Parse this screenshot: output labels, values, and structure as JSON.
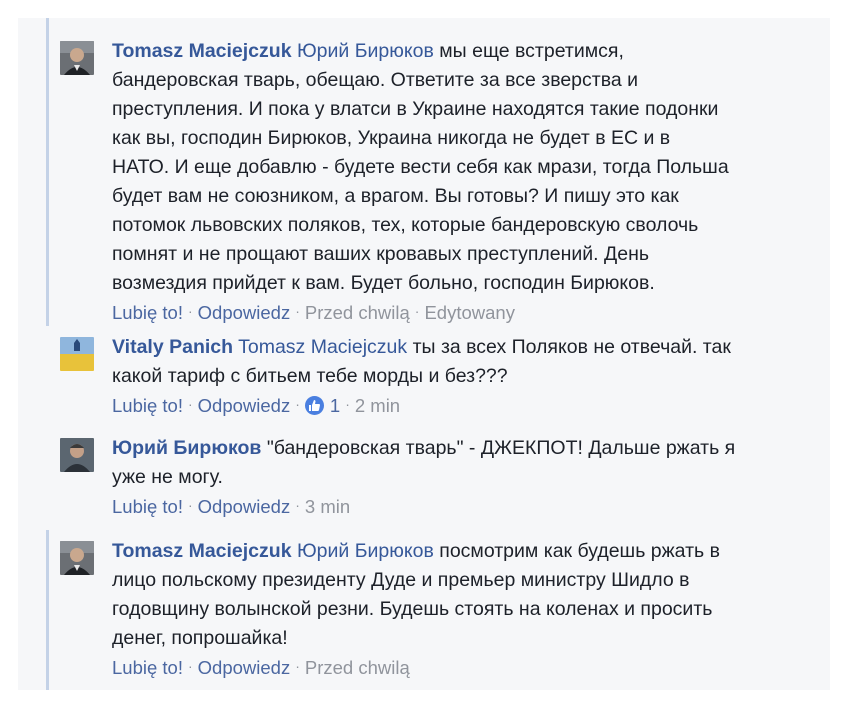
{
  "comments": [
    {
      "author": "Tomasz Maciejczuk",
      "mention": "Юрий Бирюков",
      "lines": [
        "мы еще встретимся,",
        "бандеровская тварь, обещаю. Ответите за все зверства и",
        "преступления. И пока у влатси в Украине находятся такие подонки",
        "как вы, господин Бирюков, Украина никогда не будет в ЕС и в",
        "НАТО. И еще добавлю - будете вести себя как мрази, тогда Польша",
        "будет вам не союзником, а врагом. Вы готовы? И пишу это как",
        "потомок львовских поляков, тех, которые бандеровскую сволочь",
        "помнят и не прощают ваших кровавых преступлений. День",
        "возмездия прийдет к вам. Будет больно, господин Бирюков."
      ],
      "like": "Lubię to!",
      "reply": "Odpowiedz",
      "time": "Przed chwilą",
      "edited": "Edytowany"
    },
    {
      "author": "Vitaly Panich",
      "mention": "Tomasz Maciejczuk",
      "lines": [
        "ты за всех Поляков не отвечай. так",
        "какой тариф с битьем тебе морды и без???"
      ],
      "like": "Lubię to!",
      "reply": "Odpowiedz",
      "reaction_count": "1",
      "time": "2 min"
    },
    {
      "author": "Юрий Бирюков",
      "lines": [
        "\"бандеровская тварь\" - ДЖЕКПОТ! Дальше ржать я",
        "уже не могу."
      ],
      "like": "Lubię to!",
      "reply": "Odpowiedz",
      "time": "3 min"
    },
    {
      "author": "Tomasz Maciejczuk",
      "mention": "Юрий Бирюков",
      "lines": [
        "посмотрим как будешь ржать в",
        "лицо польскому президенту Дуде и премьер министру Шидло в",
        "годовщину волынской резни. Будешь стоять на коленах и просить",
        "денег, попрошайка!"
      ],
      "like": "Lubię to!",
      "reply": "Odpowiedz",
      "time": "Przed chwilą"
    }
  ],
  "colors": {
    "author": "#365899",
    "meta": "#90949c",
    "action": "#4b67a1",
    "text": "#1d2129",
    "thread": "#c4d2e7",
    "background": "#f6f7f9"
  },
  "icons": {
    "like_reaction": "thumbs-up-icon"
  }
}
